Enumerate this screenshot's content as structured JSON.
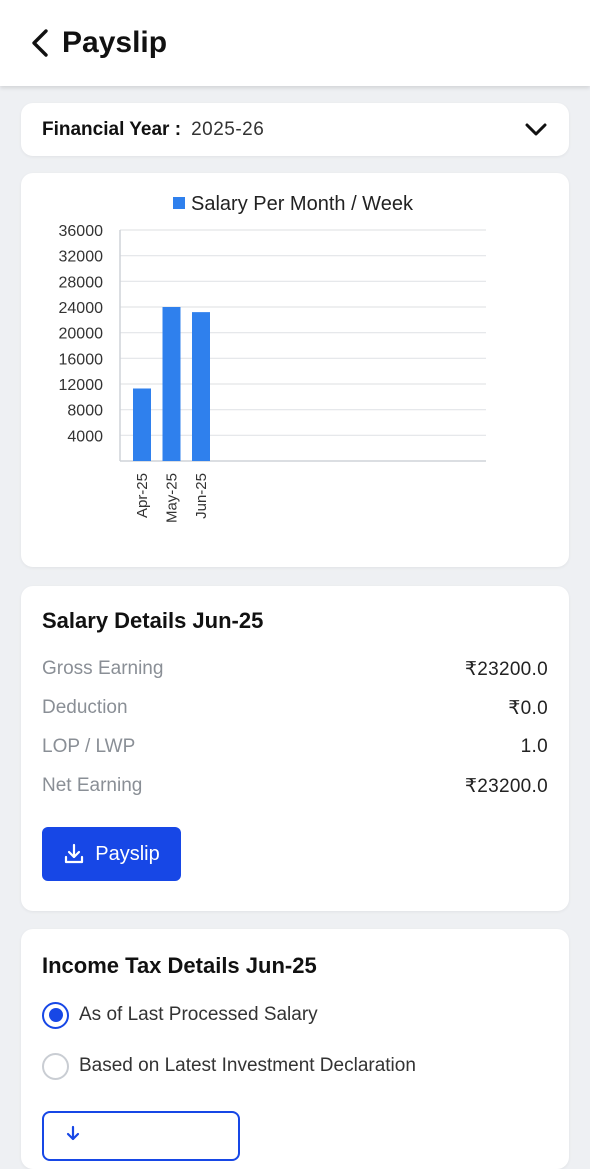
{
  "header": {
    "title": "Payslip"
  },
  "financial_year": {
    "label": "Financial Year :",
    "value": "2025-26"
  },
  "chart_data": {
    "type": "bar",
    "legend": "Salary Per Month / Week",
    "legend_color": "#2f80ed",
    "categories": [
      "Apr-25",
      "May-25",
      "Jun-25"
    ],
    "values": [
      11300,
      24000,
      23200
    ],
    "ylim": [
      0,
      36000
    ],
    "yticks": [
      4000,
      8000,
      12000,
      16000,
      20000,
      24000,
      28000,
      32000,
      36000
    ],
    "grid": true,
    "bar_color": "#2f80ed"
  },
  "salary": {
    "heading": "Salary Details Jun-25",
    "rows": [
      {
        "label": "Gross Earning",
        "value": "₹23200.0"
      },
      {
        "label": "Deduction",
        "value": "₹0.0"
      },
      {
        "label": "LOP / LWP",
        "value": "1.0"
      },
      {
        "label": "Net Earning",
        "value": "₹23200.0"
      }
    ],
    "download_label": "Payslip"
  },
  "income_tax": {
    "heading": "Income Tax Details Jun-25",
    "options": [
      {
        "label": "As of Last Processed Salary",
        "selected": true
      },
      {
        "label": "Based on Latest Investment Declaration",
        "selected": false
      }
    ]
  },
  "colors": {
    "accent": "#1747e6",
    "background": "#eef0f3"
  }
}
